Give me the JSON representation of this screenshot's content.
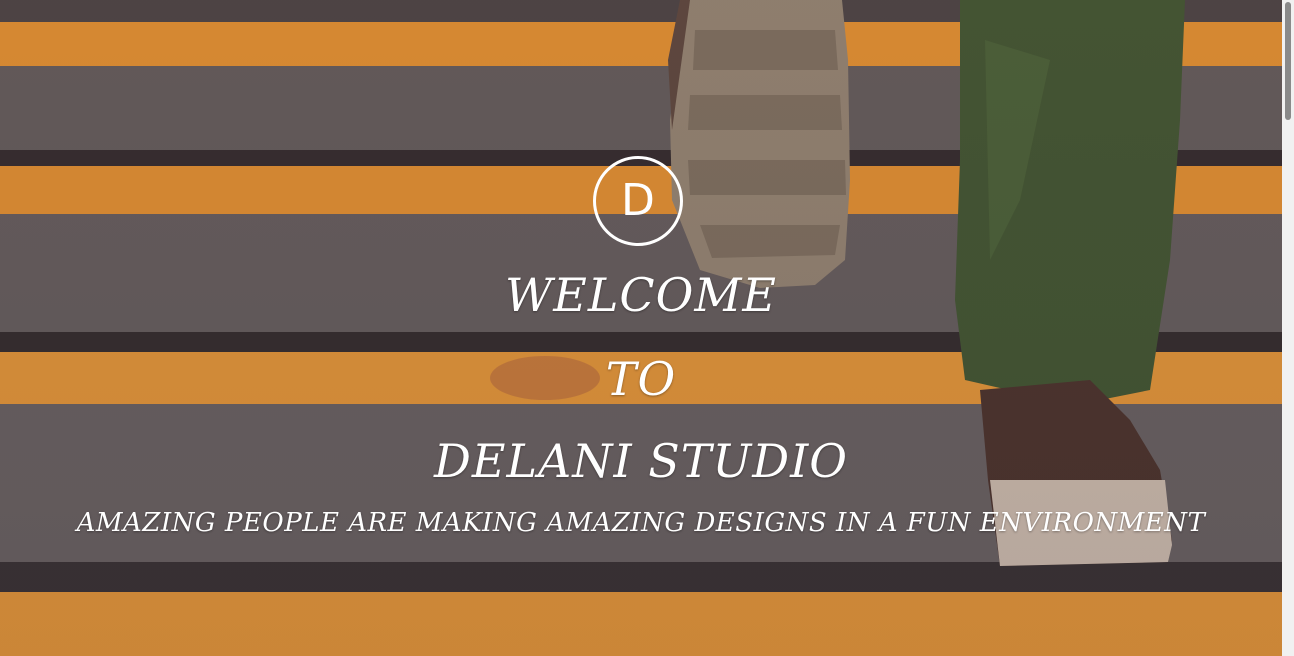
{
  "hero": {
    "logo_letter": "D",
    "welcome": "WELCOME",
    "to": "TO",
    "studio": "DELANI STUDIO",
    "tagline": "AMAZING PEOPLE ARE MAKING AMAZING DESIGNS IN A FUN ENVIRONMENT"
  },
  "colors": {
    "stair_stripe": "#f19a2e",
    "stair_concrete": "#5f5a57",
    "stair_edge": "#2f2b2a",
    "text": "#ffffff"
  }
}
